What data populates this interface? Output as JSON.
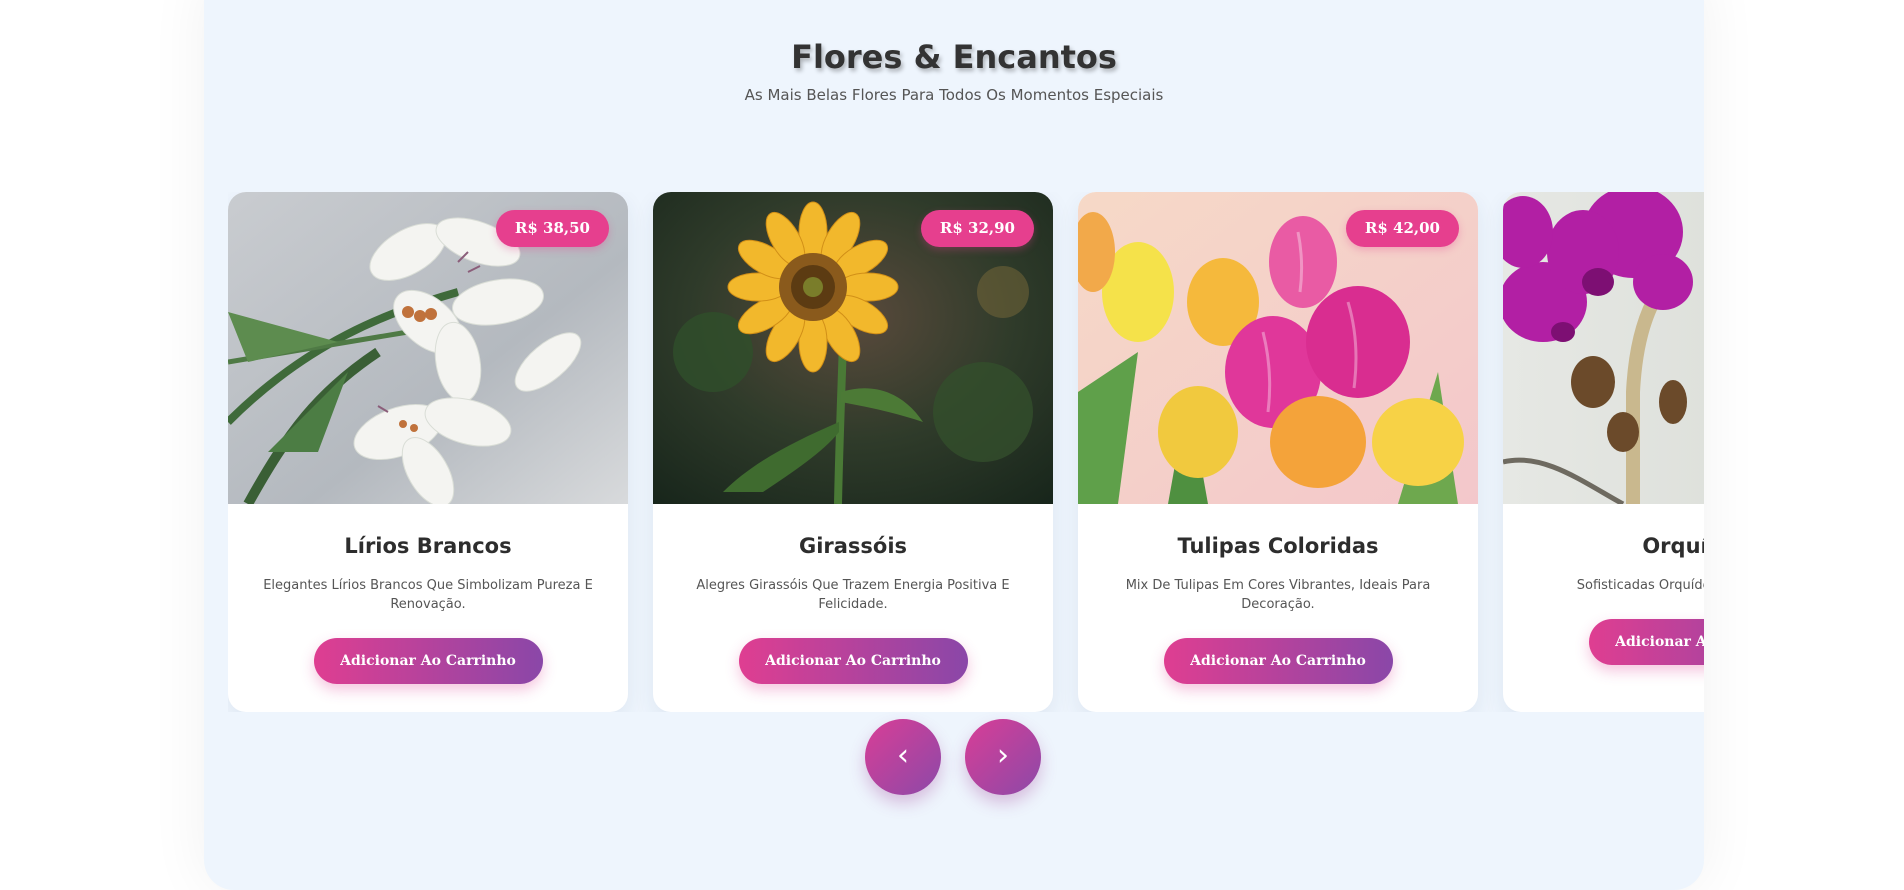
{
  "header": {
    "title": "Flores & Encantos",
    "subtitle": "As Mais Belas Flores Para Todos Os Momentos Especiais"
  },
  "products": [
    {
      "name": "Lírios Brancos",
      "description": "Elegantes Lírios Brancos Que Simbolizam Pureza E Renovação.",
      "price": "R$ 38,50",
      "button": "Adicionar Ao Carrinho",
      "image": "white-lilies-photo"
    },
    {
      "name": "Girassóis",
      "description": "Alegres Girassóis Que Trazem Energia Positiva E Felicidade.",
      "price": "R$ 32,90",
      "button": "Adicionar Ao Carrinho",
      "image": "sunflower-photo"
    },
    {
      "name": "Tulipas Coloridas",
      "description": "Mix De Tulipas Em Cores Vibrantes, Ideais Para Decoração.",
      "price": "R$ 42,00",
      "button": "Adicionar Ao Carrinho",
      "image": "tulips-photo"
    },
    {
      "name": "Orquídeas",
      "description": "Sofisticadas Orquídeas Para Elegância.",
      "price": "",
      "button": "Adicionar Ao Carrinho",
      "image": "orchid-photo"
    }
  ],
  "carousel": {
    "prev_label": "‹",
    "next_label": "›"
  },
  "colors": {
    "background": "#eef5fd",
    "accent_pink": "#e63f8e",
    "gradient_start": "#df3e91",
    "gradient_end": "#8a47a8"
  }
}
